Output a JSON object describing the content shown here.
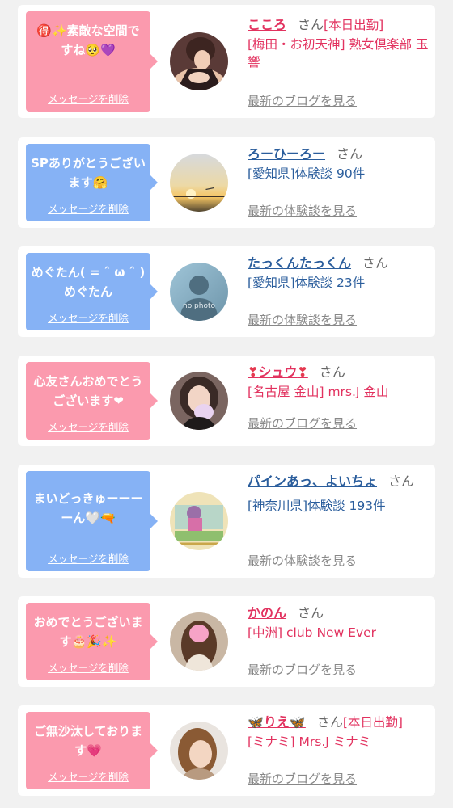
{
  "colors": {
    "pink_bubble": "#fb9aae",
    "blue_bubble": "#86b2f5",
    "pink_text": "#e2325f",
    "blue_text": "#2a5d9c",
    "muted": "#888888",
    "page_bg": "#f1f1f1"
  },
  "delete_label": "メッセージを削除",
  "san_label": "さん",
  "cards": [
    {
      "message": "🉐✨素敵な空間ですね🥺💜",
      "name": "こころ",
      "status": "[本日出勤]",
      "shop": "[梅田・お初天神] 熟女倶楽部 玉響",
      "more": "最新のブログを見る",
      "avatar_icon": "woman-photo"
    },
    {
      "message": "SPありがとうございます🤗",
      "name": "ろーひーろー",
      "status": "",
      "shop": "[愛知県]体験談 90件",
      "more": "最新の体験談を見る",
      "avatar_icon": "sunset-photo"
    },
    {
      "message": "めぐたん( = ˆ ω ˆ ) めぐたん",
      "name": "たっくんたっくん",
      "status": "",
      "shop": "[愛知県]体験談 23件",
      "more": "最新の体験談を見る",
      "avatar_icon": "no-photo-placeholder",
      "avatar_text": "no photo"
    },
    {
      "message": "心友さんおめでとうございます❤",
      "name": "シュウ",
      "status": "",
      "shop": "[名古屋 金山] mrs.J 金山",
      "more": "最新のブログを見る",
      "avatar_icon": "woman-photo"
    },
    {
      "message": "まいどっきゅーーーーん🤍🔫",
      "name": "パインあっ、よいちょ",
      "status": "",
      "shop": "[神奈川県]体験談 193件",
      "more": "最新の体験談を見る",
      "avatar_icon": "drawing-photo"
    },
    {
      "message": "おめでとうございます🎂🎉✨",
      "name": "かのん",
      "status": "",
      "shop": "[中洲] club New Ever",
      "more": "最新のブログを見る",
      "avatar_icon": "woman-photo"
    },
    {
      "message": "ご無沙汰しております💗",
      "name": "🦋りえ🦋",
      "status": "[本日出勤]",
      "shop": "[ミナミ] Mrs.J ミナミ",
      "more": "最新のブログを見る",
      "avatar_icon": "woman-photo"
    }
  ]
}
